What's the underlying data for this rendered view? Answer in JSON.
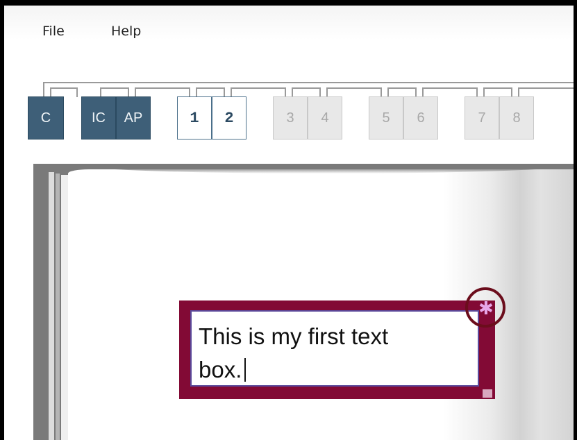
{
  "menu": {
    "file": "File",
    "help": "Help"
  },
  "tabs": [
    {
      "label": "C",
      "state": "active-section"
    },
    {
      "label": "IC",
      "state": "active-section"
    },
    {
      "label": "AP",
      "state": "active-section"
    },
    {
      "label": "1",
      "state": "current-page"
    },
    {
      "label": "2",
      "state": "current-page"
    },
    {
      "label": "3",
      "state": "disabled"
    },
    {
      "label": "4",
      "state": "disabled"
    },
    {
      "label": "5",
      "state": "disabled"
    },
    {
      "label": "6",
      "state": "disabled"
    },
    {
      "label": "7",
      "state": "disabled"
    },
    {
      "label": "8",
      "state": "disabled"
    }
  ],
  "textbox": {
    "line1": "This is my first text",
    "line2": "box."
  },
  "icons": {
    "move_handle": "asterisk-move-icon",
    "resize_handle": "resize-corner-icon"
  },
  "colors": {
    "section_tab": "#3e5f78",
    "textbox_border": "#820a35",
    "highlight_circle": "#6b0d1c"
  }
}
